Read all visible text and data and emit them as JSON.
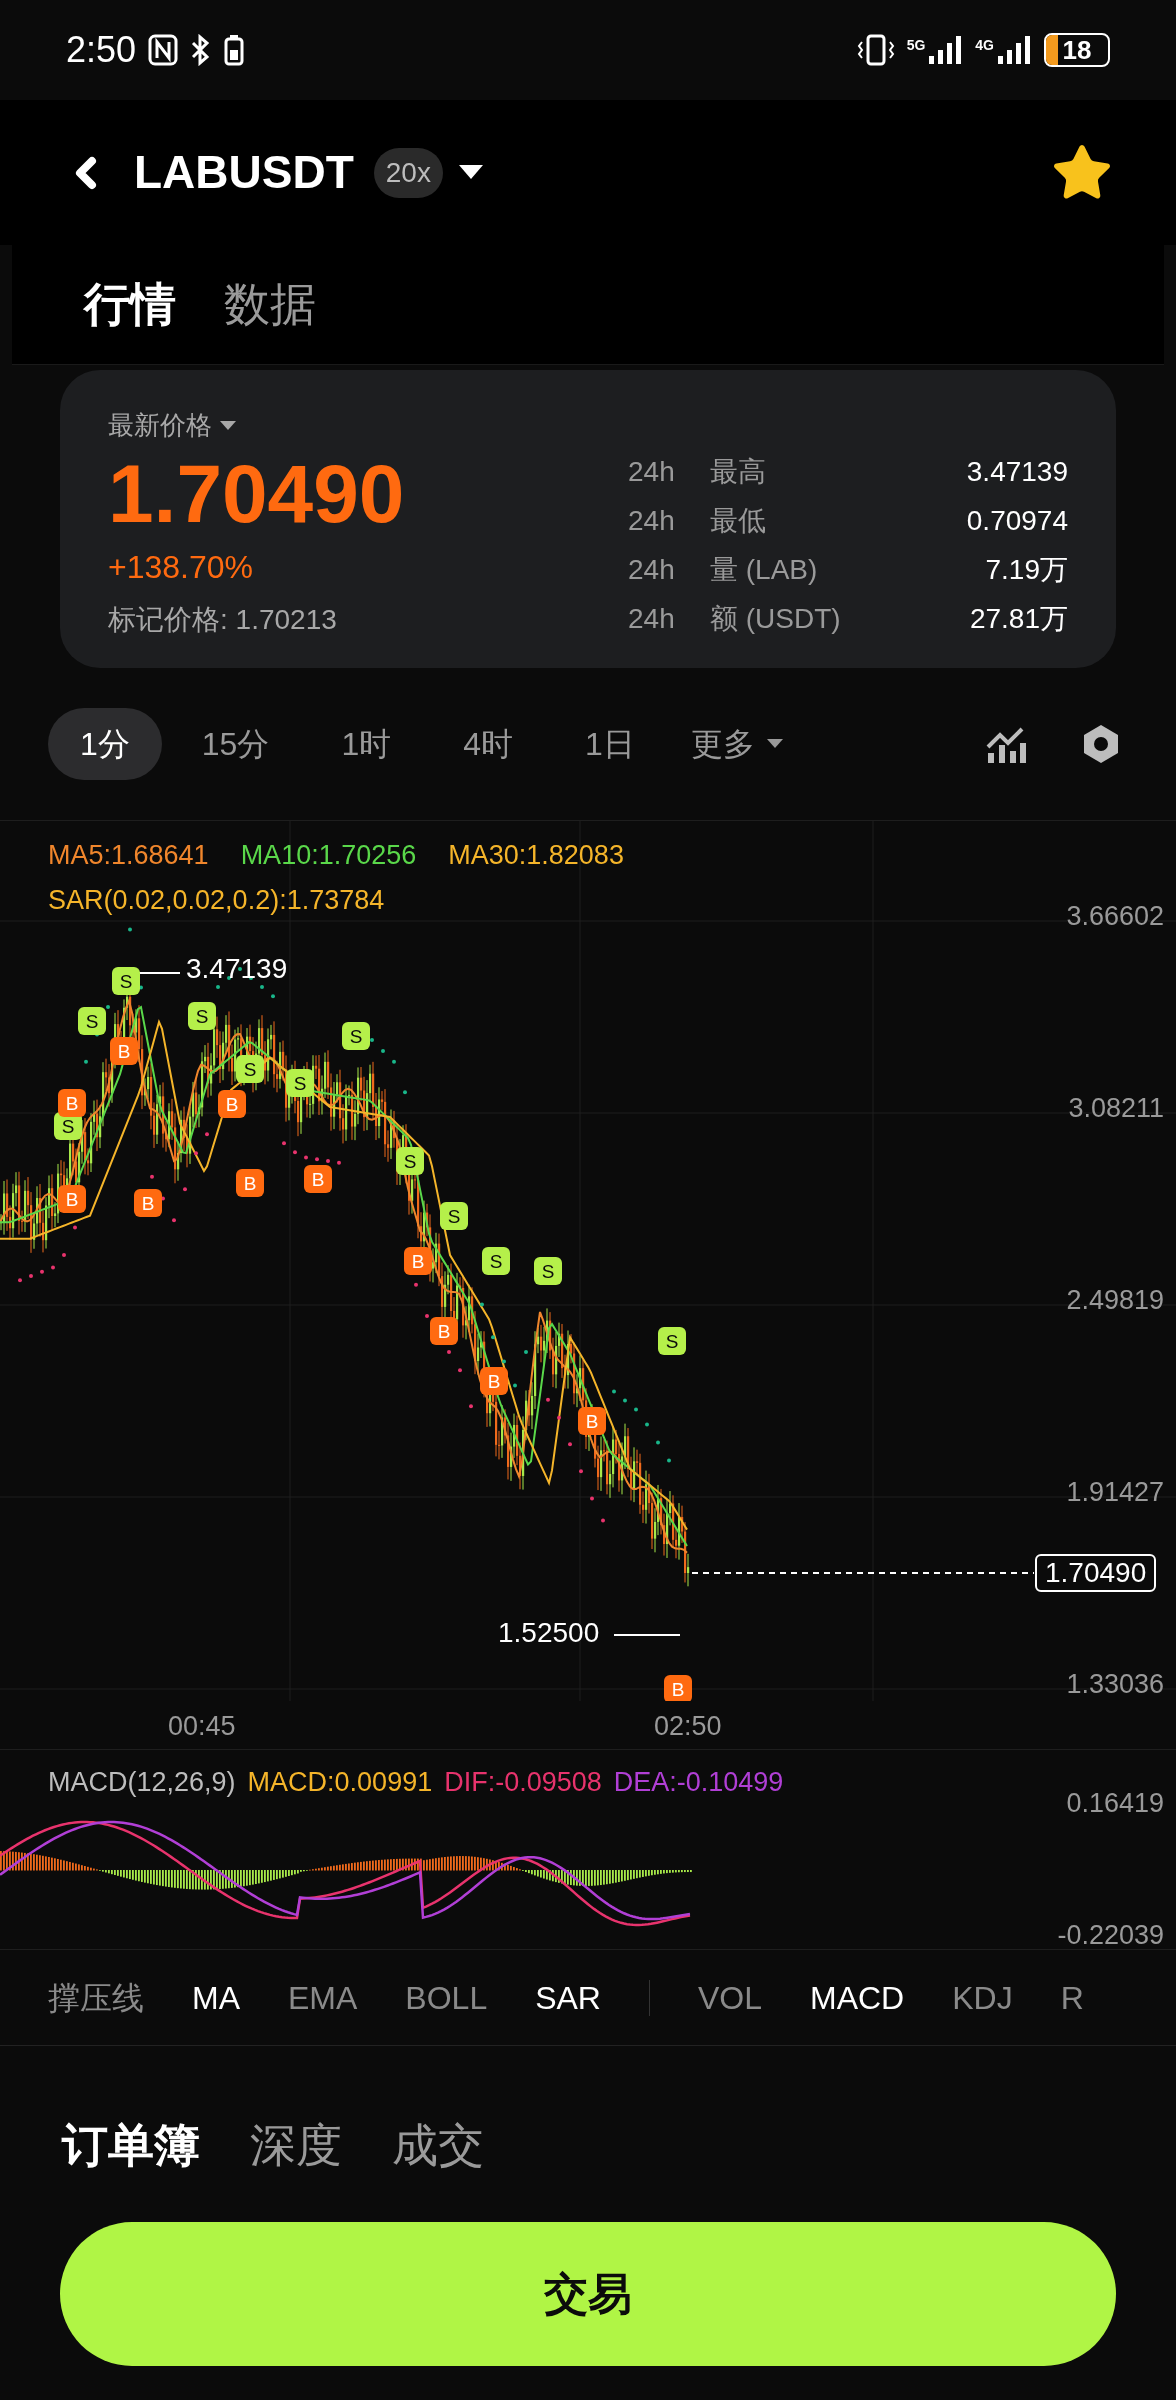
{
  "status_bar": {
    "time": "2:50",
    "network_1": "5G",
    "network_2": "4G",
    "battery": "18"
  },
  "header": {
    "symbol": "LABUSDT",
    "leverage": "20x",
    "favorite": true
  },
  "tabs": [
    {
      "label": "行情",
      "selected": true
    },
    {
      "label": "数据",
      "selected": false
    }
  ],
  "price_card": {
    "label": "最新价格",
    "last_price": "1.70490",
    "change": "+138.70%",
    "mark_price": "标记价格: 1.70213",
    "stats": [
      {
        "period": "24h",
        "label": "最高",
        "value": "3.47139"
      },
      {
        "period": "24h",
        "label": "最低",
        "value": "0.70974"
      },
      {
        "period": "24h",
        "label": "量 (LAB)",
        "value": "7.19万"
      },
      {
        "period": "24h",
        "label": "额 (USDT)",
        "value": "27.81万"
      }
    ]
  },
  "timeframes": [
    {
      "label": "1分",
      "selected": true
    },
    {
      "label": "15分",
      "selected": false
    },
    {
      "label": "1时",
      "selected": false
    },
    {
      "label": "4时",
      "selected": false
    },
    {
      "label": "1日",
      "selected": false
    }
  ],
  "more": "更多",
  "chart": {
    "legend": [
      {
        "text": "MA5:1.68641",
        "color": "#f0862c"
      },
      {
        "text": "MA10:1.70256",
        "color": "#5ad84a"
      },
      {
        "text": "MA30:1.82083",
        "color": "#f5b52a"
      }
    ],
    "sar": "SAR(0.02,0.02,0.2):1.73784",
    "y_ticks": [
      "3.66602",
      "3.08211",
      "2.49819",
      "1.91427",
      "1.33036"
    ],
    "high_label": "3.47139",
    "low_label": "1.52500",
    "last_price": "1.70490",
    "x_ticks": [
      "00:45",
      "02:50"
    ],
    "markers": [
      {
        "kind": "sell",
        "label": "S"
      },
      {
        "kind": "sell",
        "label": "S"
      },
      {
        "kind": "sell",
        "label": "S"
      },
      {
        "kind": "sell",
        "label": "S"
      },
      {
        "kind": "sell",
        "label": "S"
      },
      {
        "kind": "sell",
        "label": "S"
      },
      {
        "kind": "sell",
        "label": "S"
      },
      {
        "kind": "sell",
        "label": "S"
      },
      {
        "kind": "sell",
        "label": "S"
      },
      {
        "kind": "sell",
        "label": "S"
      },
      {
        "kind": "sell",
        "label": "S"
      },
      {
        "kind": "sell",
        "label": "S"
      },
      {
        "kind": "buy",
        "label": "B"
      },
      {
        "kind": "buy",
        "label": "B"
      },
      {
        "kind": "buy",
        "label": "B"
      },
      {
        "kind": "buy",
        "label": "B"
      },
      {
        "kind": "buy",
        "label": "B"
      },
      {
        "kind": "buy",
        "label": "B"
      },
      {
        "kind": "buy",
        "label": "B"
      },
      {
        "kind": "buy",
        "label": "B"
      },
      {
        "kind": "buy",
        "label": "B"
      },
      {
        "kind": "buy",
        "label": "B"
      },
      {
        "kind": "buy",
        "label": "B"
      },
      {
        "kind": "buy",
        "label": "B"
      }
    ]
  },
  "macd": {
    "title": "MACD(12,26,9)",
    "values": [
      {
        "text": "MACD:0.00991",
        "color": "#f5b52a"
      },
      {
        "text": "DIF:-0.09508",
        "color": "#e8336d"
      },
      {
        "text": "DEA:-0.10499",
        "color": "#b13fd6"
      }
    ],
    "y_ticks": [
      "0.16419",
      "-0.22039"
    ]
  },
  "indicators": {
    "main": [
      {
        "label": "撑压线",
        "selected": false
      },
      {
        "label": "MA",
        "selected": true
      },
      {
        "label": "EMA",
        "selected": false
      },
      {
        "label": "BOLL",
        "selected": false
      },
      {
        "label": "SAR",
        "selected": true
      }
    ],
    "sub": [
      {
        "label": "VOL",
        "selected": false
      },
      {
        "label": "MACD",
        "selected": true
      },
      {
        "label": "KDJ",
        "selected": false
      },
      {
        "label": "R",
        "selected": false
      }
    ]
  },
  "bottom_tabs": [
    {
      "label": "订单簿",
      "selected": true
    },
    {
      "label": "深度",
      "selected": false
    },
    {
      "label": "成交",
      "selected": false
    }
  ],
  "trade_button": "交易"
}
